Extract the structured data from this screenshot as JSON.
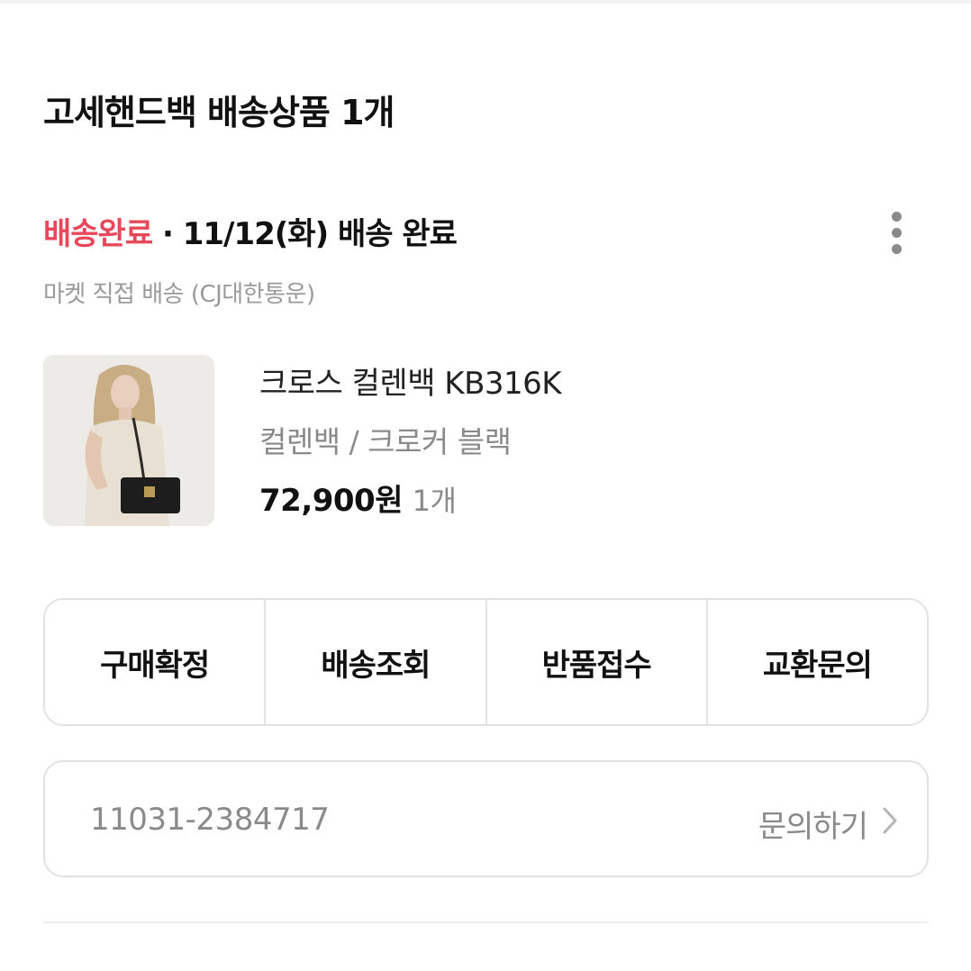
{
  "seller": {
    "title": "고세핸드백 배송상품 1개"
  },
  "delivery": {
    "status_label": "배송완료",
    "status_detail": " · 11/12(화) 배송 완료",
    "method": "마켓 직접 배송 (CJ대한통운)",
    "more_icon": "more-vertical-icon"
  },
  "product": {
    "name": "크로스 컬렌백 KB316K",
    "option": "컬렌백 / 크로커 블랙",
    "price": "72,900원",
    "quantity": "1개"
  },
  "actions": [
    {
      "label": "구매확정"
    },
    {
      "label": "배송조회"
    },
    {
      "label": "반품접수"
    },
    {
      "label": "교환문의"
    }
  ],
  "order": {
    "number": "11031-2384717",
    "inquiry_label": "문의하기",
    "inquiry_icon": "chevron-right-icon"
  },
  "colors": {
    "status_accent": "#e8485a",
    "muted_text": "#8a8a8a",
    "border": "#e2e2e2"
  }
}
